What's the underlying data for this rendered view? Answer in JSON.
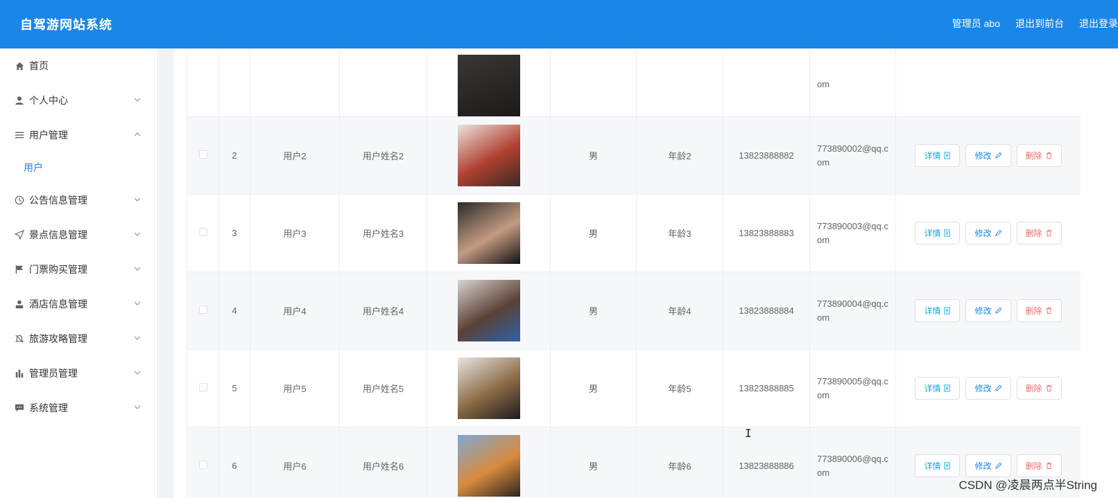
{
  "header": {
    "brand": "自驾游网站系统",
    "admin_label": "管理员 abo",
    "to_front": "退出到前台",
    "logout": "退出登录"
  },
  "sidebar": {
    "items": [
      {
        "label": "首页",
        "icon": "home-icon",
        "expandable": false
      },
      {
        "label": "个人中心",
        "icon": "user-icon",
        "expandable": true
      },
      {
        "label": "用户管理",
        "icon": "list-icon",
        "expandable": true,
        "expanded": true,
        "children": [
          "用户"
        ]
      },
      {
        "label": "公告信息管理",
        "icon": "clock-icon",
        "expandable": true
      },
      {
        "label": "景点信息管理",
        "icon": "send-icon",
        "expandable": true
      },
      {
        "label": "门票购买管理",
        "icon": "flag-icon",
        "expandable": true
      },
      {
        "label": "酒店信息管理",
        "icon": "user-solid-icon",
        "expandable": true
      },
      {
        "label": "旅游攻略管理",
        "icon": "bell-icon",
        "expandable": true
      },
      {
        "label": "管理员管理",
        "icon": "bar-chart-icon",
        "expandable": true
      },
      {
        "label": "系统管理",
        "icon": "chat-icon",
        "expandable": true
      }
    ]
  },
  "table": {
    "buttons": {
      "detail": "详情",
      "edit": "修改",
      "delete": "删除"
    },
    "partial_top": {
      "email_tail": "om"
    },
    "rows": [
      {
        "index": "2",
        "account": "用户2",
        "name": "用户姓名2",
        "gender": "男",
        "age": "年龄2",
        "phone": "13823888882",
        "email": "773890002@qq.com",
        "photo_colors": [
          "#ede3dc",
          "#b04030",
          "#3a2a24"
        ]
      },
      {
        "index": "3",
        "account": "用户3",
        "name": "用户姓名3",
        "gender": "男",
        "age": "年龄3",
        "phone": "13823888883",
        "email": "773890003@qq.com",
        "photo_colors": [
          "#2a2b28",
          "#c49b82",
          "#111111"
        ]
      },
      {
        "index": "4",
        "account": "用户4",
        "name": "用户姓名4",
        "gender": "男",
        "age": "年龄4",
        "phone": "13823888884",
        "email": "773890004@qq.com",
        "photo_colors": [
          "#d8d4cf",
          "#5a4136",
          "#2d62a8"
        ]
      },
      {
        "index": "5",
        "account": "用户5",
        "name": "用户姓名5",
        "gender": "男",
        "age": "年龄5",
        "phone": "13823888885",
        "email": "773890005@qq.com",
        "photo_colors": [
          "#e9e5e2",
          "#8a6a45",
          "#1c1c1e"
        ]
      },
      {
        "index": "6",
        "account": "用户6",
        "name": "用户姓名6",
        "gender": "男",
        "age": "年龄6",
        "phone": "13823888886",
        "email": "773890006@qq.com",
        "photo_colors": [
          "#7fa9d6",
          "#d98a3c",
          "#2a2420"
        ]
      }
    ]
  },
  "watermark": "CSDN @凌晨两点半String"
}
